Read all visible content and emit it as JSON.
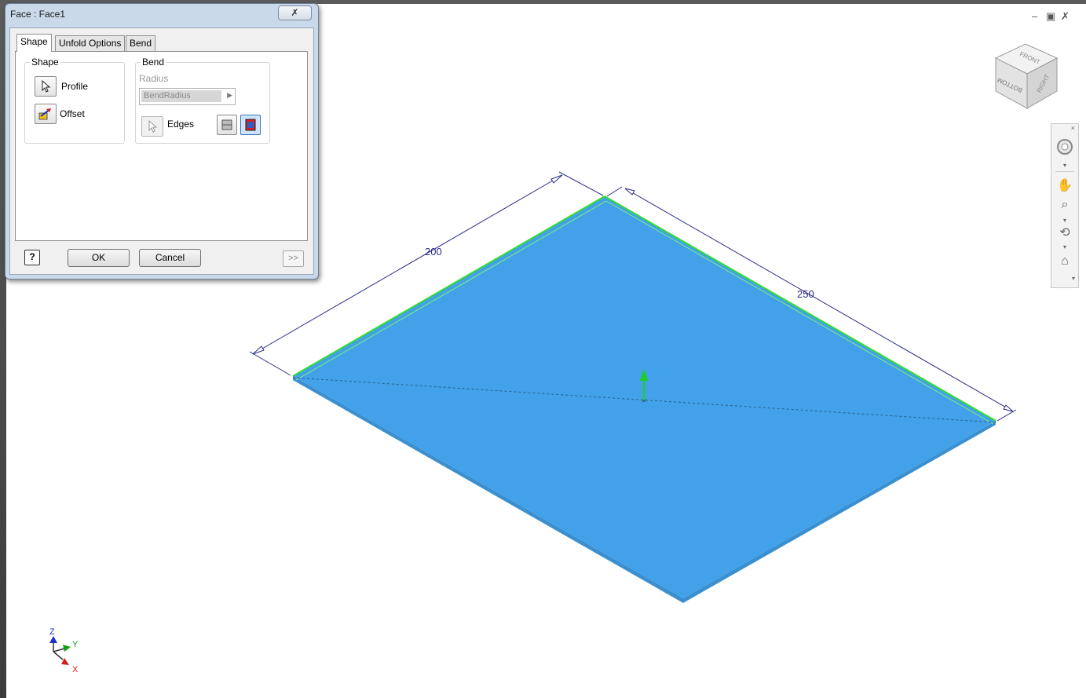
{
  "dialog": {
    "title": "Face : Face1",
    "close_glyph": "✗",
    "tabs": [
      "Shape",
      "Unfold Options",
      "Bend"
    ],
    "shape_group": {
      "label": "Shape",
      "profile_label": "Profile",
      "offset_label": "Offset"
    },
    "bend_group": {
      "label": "Bend",
      "radius_label": "Radius",
      "radius_value": "BendRadius",
      "edges_label": "Edges"
    },
    "help_glyph": "?",
    "ok_label": "OK",
    "cancel_label": "Cancel",
    "more_label": ">>"
  },
  "viewport": {
    "dimension_width": "200",
    "dimension_length": "250",
    "face_color": "#42a1e8",
    "edge_highlight_color": "#33dd33",
    "dimension_color": "#2a2a8a"
  },
  "viewcube": {
    "faces": [
      "FRONT",
      "BOTTOM",
      "RIGHT"
    ]
  },
  "triad": {
    "x": "X",
    "y": "Y",
    "z": "Z"
  },
  "window_controls": [
    "–",
    "▣",
    "✗"
  ]
}
